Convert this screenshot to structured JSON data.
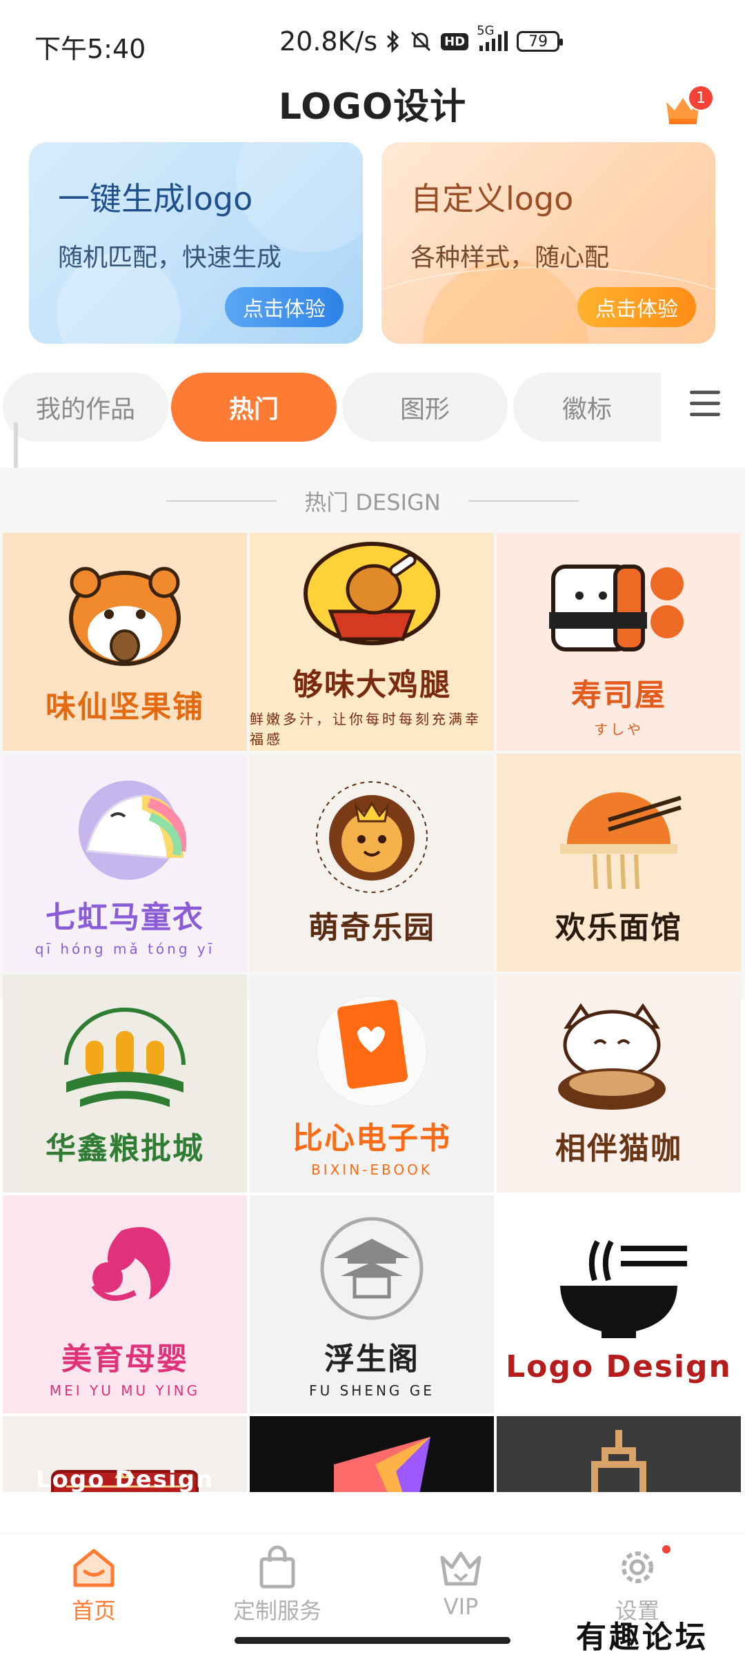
{
  "status_bar": {
    "time": "下午5:40",
    "net_speed": "20.8K/s",
    "hd": "HD",
    "signal": "5G",
    "battery": "79"
  },
  "header": {
    "title": "LOGO设计",
    "notification_count": "1"
  },
  "promos": [
    {
      "title": "一键生成logo",
      "subtitle": "随机匹配，快速生成",
      "button": "点击体验"
    },
    {
      "title": "自定义logo",
      "subtitle": "各种样式，随心配",
      "button": "点击体验"
    }
  ],
  "tabs": [
    {
      "label": "我的作品"
    },
    {
      "label": "热门",
      "active": true
    },
    {
      "label": "图形"
    },
    {
      "label": "徽标"
    }
  ],
  "section_title": "热门 DESIGN",
  "tiles": [
    {
      "name": "味仙坚果铺",
      "sub": "",
      "bg": "#fde3c4",
      "color": "#e36a10",
      "art": "hamster"
    },
    {
      "name": "够味大鸡腿",
      "sub": "鲜嫩多汁，让你每时每刻充满幸福感",
      "bg": "#fde8c8",
      "color": "#7a2a0e",
      "art": "chicken"
    },
    {
      "name": "寿司屋",
      "sub": "すしや",
      "bg": "#fdebe2",
      "color": "#e35a1a",
      "art": "sushi"
    },
    {
      "name": "七虹马童衣",
      "sub": "qī hóng mǎ tóng yī",
      "bg": "#f6f1f8",
      "color": "#8a5cd8",
      "art": "unicorn"
    },
    {
      "name": "萌奇乐园",
      "sub": "",
      "bg": "#f5f2ee",
      "color": "#5a2c12",
      "art": "lion"
    },
    {
      "name": "欢乐面馆",
      "sub": "",
      "bg": "#fbe8cf",
      "color": "#2a1b10",
      "art": "noodle"
    },
    {
      "name": "华鑫粮批城",
      "sub": "",
      "bg": "#efece6",
      "color": "#2e7d32",
      "art": "wheat"
    },
    {
      "name": "比心电子书",
      "sub": "BIXIN-EBOOK",
      "bg": "#f3f3f3",
      "color": "#ff6a13",
      "art": "book"
    },
    {
      "name": "相伴猫咖",
      "sub": "",
      "bg": "#fbf1ec",
      "color": "#6a3514",
      "art": "cat"
    },
    {
      "name": "美育母婴",
      "sub": "MEI   YU   MU   YING",
      "bg": "#fbe6ef",
      "color": "#e0317a",
      "art": "mother"
    },
    {
      "name": "浮生阁",
      "sub": "FU   SHENG   GE",
      "bg": "#f2f2f2",
      "color": "#222222",
      "art": "pavilion"
    },
    {
      "name": "Logo Design",
      "sub": "",
      "bg": "#ffffff",
      "color": "#b71c1c",
      "art": "bowl"
    },
    {
      "name": "Logo Design",
      "sub": "",
      "bg": "#f5efec",
      "color": "#ffffff",
      "art": "badge"
    },
    {
      "name": "",
      "sub": "",
      "bg": "#101010",
      "color": "#ffffff",
      "art": "prism"
    },
    {
      "name": "",
      "sub": "",
      "bg": "#3a3a3a",
      "color": "#ffffff",
      "art": "building"
    }
  ],
  "bottom_nav": [
    {
      "label": "首页",
      "icon": "home-icon",
      "active": true
    },
    {
      "label": "定制服务",
      "icon": "bag-icon"
    },
    {
      "label": "VIP",
      "icon": "crown-icon"
    },
    {
      "label": "设置",
      "icon": "gear-icon"
    }
  ],
  "watermark": "有趣论坛",
  "colors": {
    "accent": "#ff7a32",
    "badge": "#f44336"
  }
}
